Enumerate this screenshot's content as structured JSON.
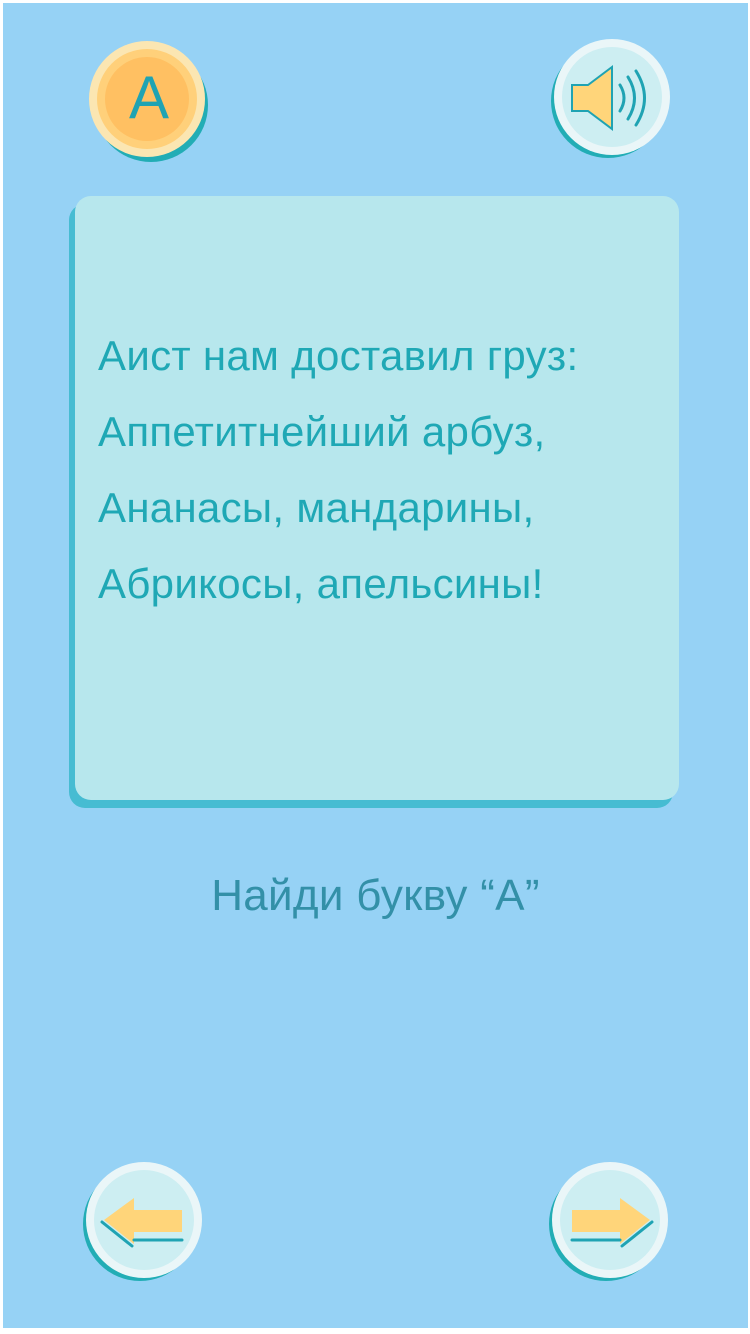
{
  "toolbar": {
    "letter_label": "А",
    "sound_icon": "speaker-icon"
  },
  "card": {
    "lines": [
      "Аист нам доставил груз:",
      "Аппетитнейший арбуз,",
      "Ананасы, мандарины,",
      "Абрикосы, апельсины!"
    ]
  },
  "instruction": "Найди букву “А”",
  "navigation": {
    "prev_icon": "arrow-left-icon",
    "next_icon": "arrow-right-icon"
  },
  "colors": {
    "background": "#96d2f5",
    "card": "#b7e7ed",
    "card_shadow": "#46bcd2",
    "text_teal": "#1fa8b5",
    "instruction_text": "#3390a8",
    "button_orange": "#ffc062",
    "button_light": "#cdeef2",
    "arrow_yellow": "#ffd57a"
  }
}
